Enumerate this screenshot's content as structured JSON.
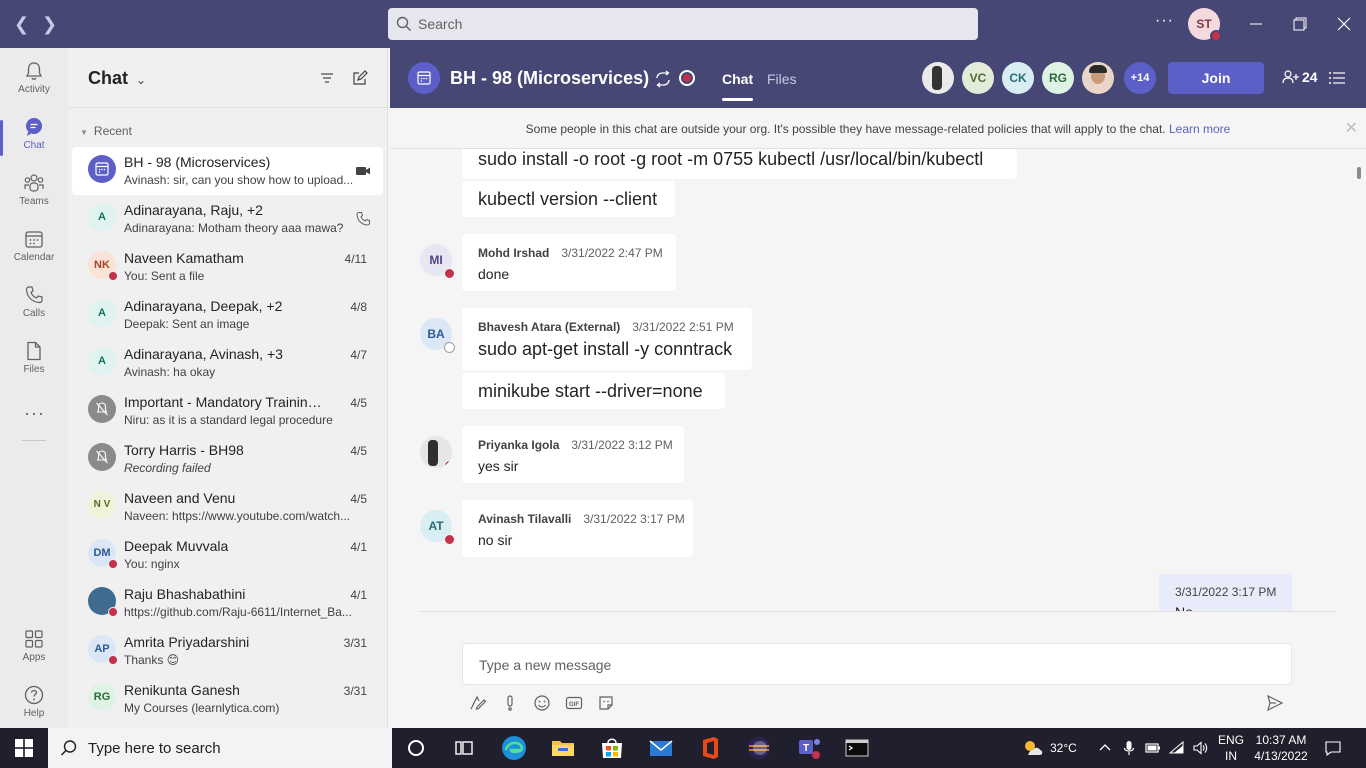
{
  "titlebar": {
    "search_placeholder": "Search",
    "more": "···",
    "user_initials": "ST"
  },
  "rail": {
    "items": [
      {
        "label": "Activity",
        "icon": "bell-icon"
      },
      {
        "label": "Chat",
        "icon": "chat-icon"
      },
      {
        "label": "Teams",
        "icon": "teams-icon"
      },
      {
        "label": "Calendar",
        "icon": "calendar-icon"
      },
      {
        "label": "Calls",
        "icon": "phone-icon"
      },
      {
        "label": "Files",
        "icon": "file-icon"
      },
      {
        "label": "Apps",
        "icon": "apps-icon"
      },
      {
        "label": "Help",
        "icon": "help-icon"
      }
    ],
    "more": "···"
  },
  "chatlist": {
    "title": "Chat",
    "section": "Recent",
    "items": [
      {
        "name": "BH - 98 (Microservices)",
        "preview": "Avinash: sir, can you show how to upload...",
        "date": "",
        "initials": ""
      },
      {
        "name": "Adinarayana, Raju, +2",
        "preview": "Adinarayana: Motham theory aaa mawa?",
        "date": "",
        "initials": "A"
      },
      {
        "name": "Naveen Kamatham",
        "preview": "You: Sent a file",
        "date": "4/11",
        "initials": "NK"
      },
      {
        "name": "Adinarayana, Deepak, +2",
        "preview": "Deepak: Sent an image",
        "date": "4/8",
        "initials": "A"
      },
      {
        "name": "Adinarayana, Avinash, +3",
        "preview": "Avinash: ha okay",
        "date": "4/7",
        "initials": "A"
      },
      {
        "name": "Important - Mandatory Training o...",
        "preview": "Niru: as it is a standard legal procedure",
        "date": "4/5",
        "initials": ""
      },
      {
        "name": "Torry Harris - BH98",
        "preview": "Recording failed",
        "date": "4/5",
        "initials": ""
      },
      {
        "name": "Naveen and Venu",
        "preview": "Naveen: https://www.youtube.com/watch...",
        "date": "4/5",
        "initials": "N V"
      },
      {
        "name": "Deepak Muvvala",
        "preview": "You: nginx",
        "date": "4/1",
        "initials": "DM"
      },
      {
        "name": "Raju Bhashabathini",
        "preview": "https://github.com/Raju-6611/Internet_Ba...",
        "date": "4/1",
        "initials": ""
      },
      {
        "name": "Amrita Priyadarshini",
        "preview": "Thanks 😊",
        "date": "3/31",
        "initials": "AP"
      },
      {
        "name": "Renikunta Ganesh",
        "preview": "My Courses (learnlytica.com)",
        "date": "3/31",
        "initials": "RG"
      }
    ]
  },
  "header": {
    "title": "BH - 98 (Microservices)",
    "tabs": [
      "Chat",
      "Files"
    ],
    "participants": [
      "VC",
      "CK",
      "RG"
    ],
    "more_count": "+14",
    "join_label": "Join",
    "people_count": "24"
  },
  "banner": {
    "text": "Some people in this chat are outside your org. It's possible they have message-related policies that will apply to the chat.",
    "link": "Learn more"
  },
  "messages": {
    "top_lines": [
      "sudo install -o root -g root -m 0755 kubectl /usr/local/bin/kubectl",
      "kubectl version --client"
    ],
    "items": [
      {
        "initials": "MI",
        "author": "Mohd Irshad",
        "time": "3/31/2022 2:47 PM",
        "lines": [
          "done"
        ]
      },
      {
        "initials": "BA",
        "author": "Bhavesh Atara (External)",
        "time": "3/31/2022 2:51 PM",
        "lines": [
          "sudo apt-get install -y conntrack",
          "minikube start --driver=none"
        ]
      },
      {
        "initials": "",
        "author": "Priyanka Igola",
        "time": "3/31/2022 3:12 PM",
        "lines": [
          "yes sir"
        ]
      },
      {
        "initials": "AT",
        "author": "Avinash Tilavalli",
        "time": "3/31/2022 3:17 PM",
        "lines": [
          "no sir"
        ]
      }
    ],
    "own": {
      "time": "3/31/2022 3:17 PM",
      "text": "No"
    }
  },
  "compose": {
    "placeholder": "Type a new message"
  },
  "taskbar": {
    "search_placeholder": "Type here to search",
    "weather": "32°C",
    "lang_top": "ENG",
    "lang_bottom": "IN",
    "time": "10:37 AM",
    "date": "4/13/2022"
  },
  "colors": {
    "brand": "#464775",
    "accent": "#5b5fc7",
    "busy": "#c4314b"
  }
}
